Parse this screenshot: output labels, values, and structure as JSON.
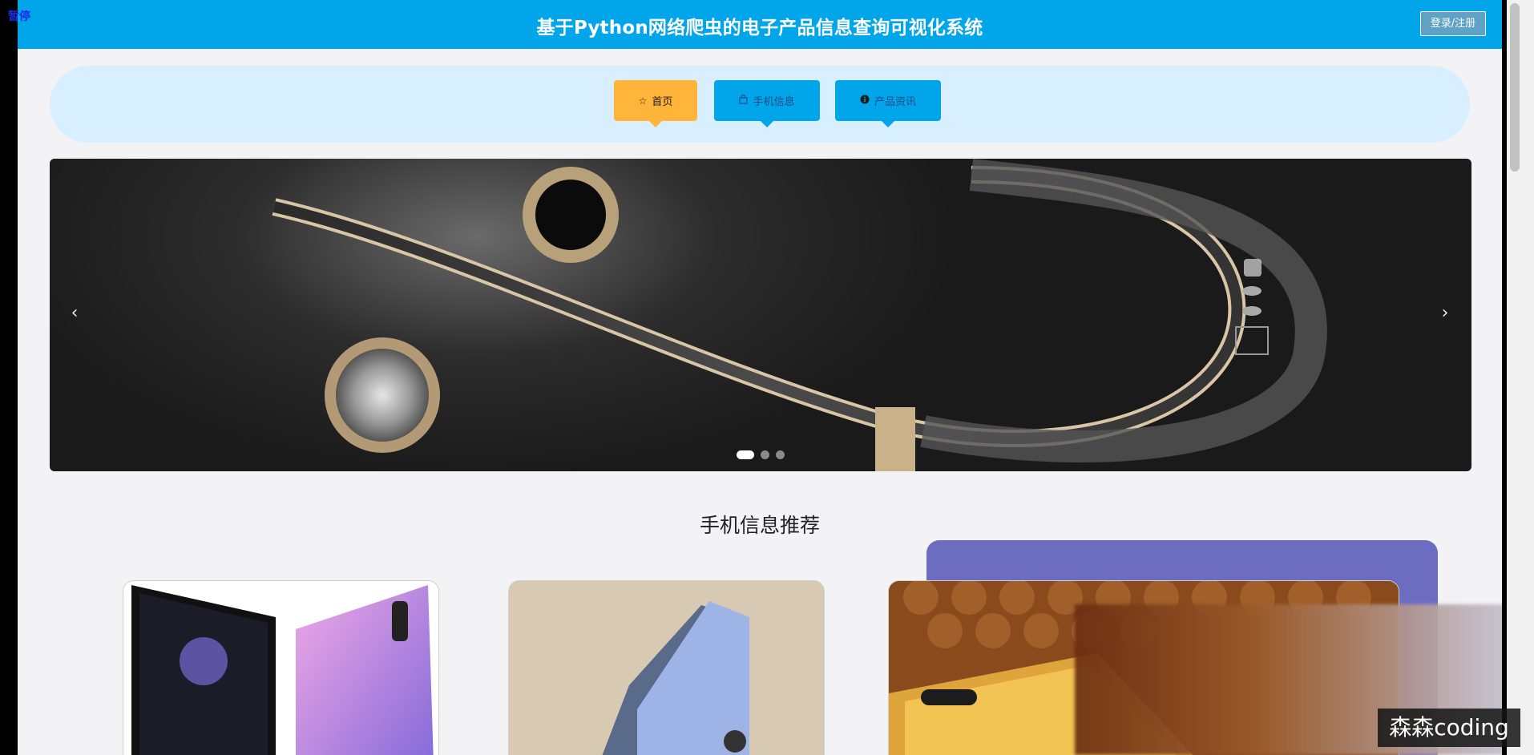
{
  "overlay": {
    "pause_label": "暂停"
  },
  "header": {
    "title": "基于Python网络爬虫的电子产品信息查询可视化系统",
    "login_label": "登录/注册"
  },
  "nav": {
    "items": [
      {
        "label": "首页",
        "icon": "star-outline-icon"
      },
      {
        "label": "手机信息",
        "icon": "bag-icon"
      },
      {
        "label": "产品资讯",
        "icon": "info-circle-icon"
      }
    ]
  },
  "carousel": {
    "prev_label": "‹",
    "next_label": "›",
    "slide_count": 3,
    "active_index": 0
  },
  "section": {
    "title": "手机信息推荐"
  },
  "watermark": {
    "text": "森森coding"
  },
  "colors": {
    "header": "#00a5ea",
    "nav_bar": "#d7efff",
    "nav_active": "#ffb43a",
    "nav_inactive": "#00a5ea",
    "purple_block": "#6c6cc0"
  }
}
